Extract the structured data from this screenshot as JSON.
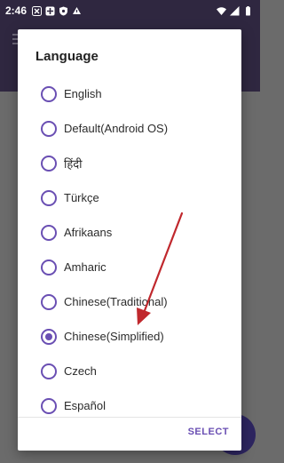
{
  "status_bar": {
    "time": "2:46"
  },
  "dialog": {
    "title": "Language",
    "options": [
      {
        "label": "English",
        "selected": false
      },
      {
        "label": "Default(Android OS)",
        "selected": false
      },
      {
        "label": "हिंदी",
        "selected": false
      },
      {
        "label": "Türkçe",
        "selected": false
      },
      {
        "label": "Afrikaans",
        "selected": false
      },
      {
        "label": "Amharic",
        "selected": false
      },
      {
        "label": "Chinese(Traditional)",
        "selected": false
      },
      {
        "label": "Chinese(Simplified)",
        "selected": true
      },
      {
        "label": "Czech",
        "selected": false
      },
      {
        "label": "Español",
        "selected": false
      }
    ],
    "select_label": "SELECT"
  },
  "colors": {
    "accent": "#6a4fb3",
    "app_bar": "#2f2740",
    "annotation_arrow": "#c0282d"
  }
}
